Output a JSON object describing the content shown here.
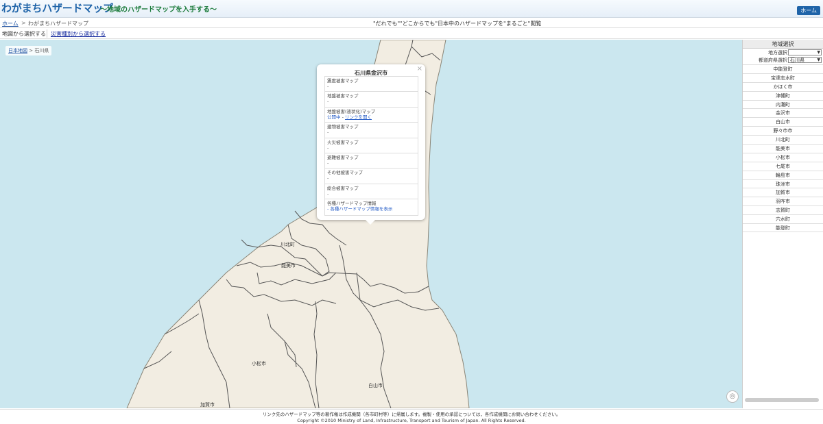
{
  "header": {
    "title": "わがまちハザードマップ",
    "subtitle": "〜地域のハザードマップを入手する〜",
    "home_button": "ホーム"
  },
  "breadcrumb": {
    "home": "ホーム",
    "separator": ">",
    "current": "わがまちハザードマップ",
    "tagline": "\"だれでも\"\"どこからでも\"日本中のハザードマップを\"まるごと\"閲覧"
  },
  "tabs": {
    "by_map": "地図から選択する",
    "by_disaster": "災害種別から選択する"
  },
  "map": {
    "crumb_root": "日本地図",
    "crumb_sep": ">",
    "crumb_current": "石川県",
    "labels": [
      "川北町",
      "能美市",
      "小松市",
      "白山市",
      "加賀市"
    ],
    "locate_icon": "◎",
    "colors": {
      "sea": "#cbe7ef",
      "land": "#f2ede2",
      "border": "#555555"
    }
  },
  "popup": {
    "close": "×",
    "title": "石川県金沢市",
    "rows": [
      {
        "name": "震度被害マップ",
        "value": "-"
      },
      {
        "name": "地盤被害マップ",
        "value": "-"
      },
      {
        "name": "地盤被害(液状化)マップ",
        "status": "公開中",
        "sep": " - ",
        "link": "リンクを開く"
      },
      {
        "name": "建物被害マップ",
        "value": "-"
      },
      {
        "name": "火災被害マップ",
        "value": "-"
      },
      {
        "name": "避難被害マップ",
        "value": "-"
      },
      {
        "name": "その他被害マップ",
        "value": "-"
      },
      {
        "name": "総合被害マップ",
        "value": "-"
      },
      {
        "name": "各種ハザードマップ情報",
        "link": "- 各種ハザードマップ情報を表示"
      }
    ]
  },
  "sidebar": {
    "title": "地域選択",
    "region_label": "地方選択",
    "region_value": "",
    "pref_label": "都道府県選択",
    "pref_value": "石川県",
    "municipalities": [
      "中能登町",
      "宝達志水町",
      "かほく市",
      "津幡町",
      "内灘町",
      "金沢市",
      "白山市",
      "野々市市",
      "川北町",
      "能美市",
      "小松市",
      "七尾市",
      "輪島市",
      "珠洲市",
      "加賀市",
      "羽咋市",
      "志賀町",
      "穴水町",
      "能登町"
    ]
  },
  "footer": {
    "line1": "リンク先のハザードマップ等の著作権は作成機関（各市町村等）に帰属します。複製・使用の承認については，各作成機関にお問い合わせください。",
    "line2": "Copyright ©2010 Ministry of Land, Infrastructure, Transport and Tourism of Japan. All Rights Reserved."
  }
}
